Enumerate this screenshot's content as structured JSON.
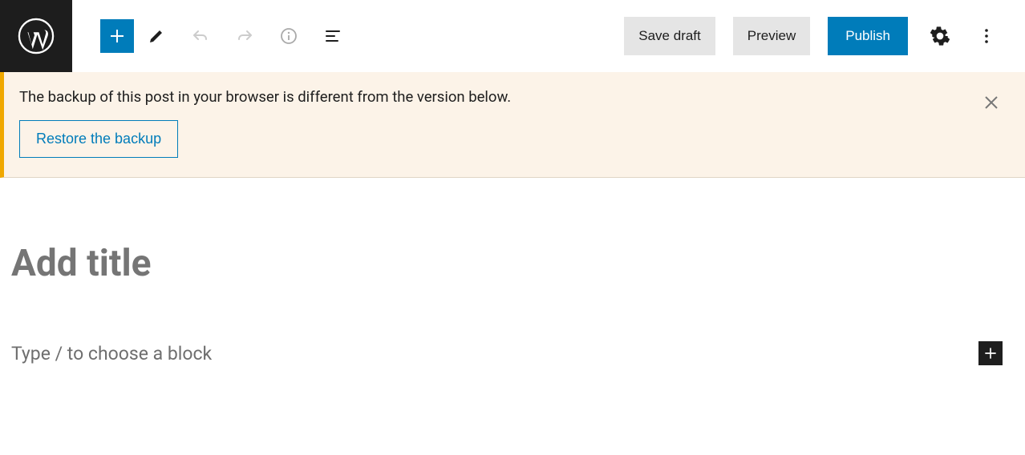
{
  "header": {
    "save_draft": "Save draft",
    "preview": "Preview",
    "publish": "Publish"
  },
  "notice": {
    "message": "The backup of this post in your browser is different from the version below.",
    "restore_label": "Restore the backup"
  },
  "editor": {
    "title_placeholder": "Add title",
    "block_placeholder": "Type / to choose a block"
  }
}
